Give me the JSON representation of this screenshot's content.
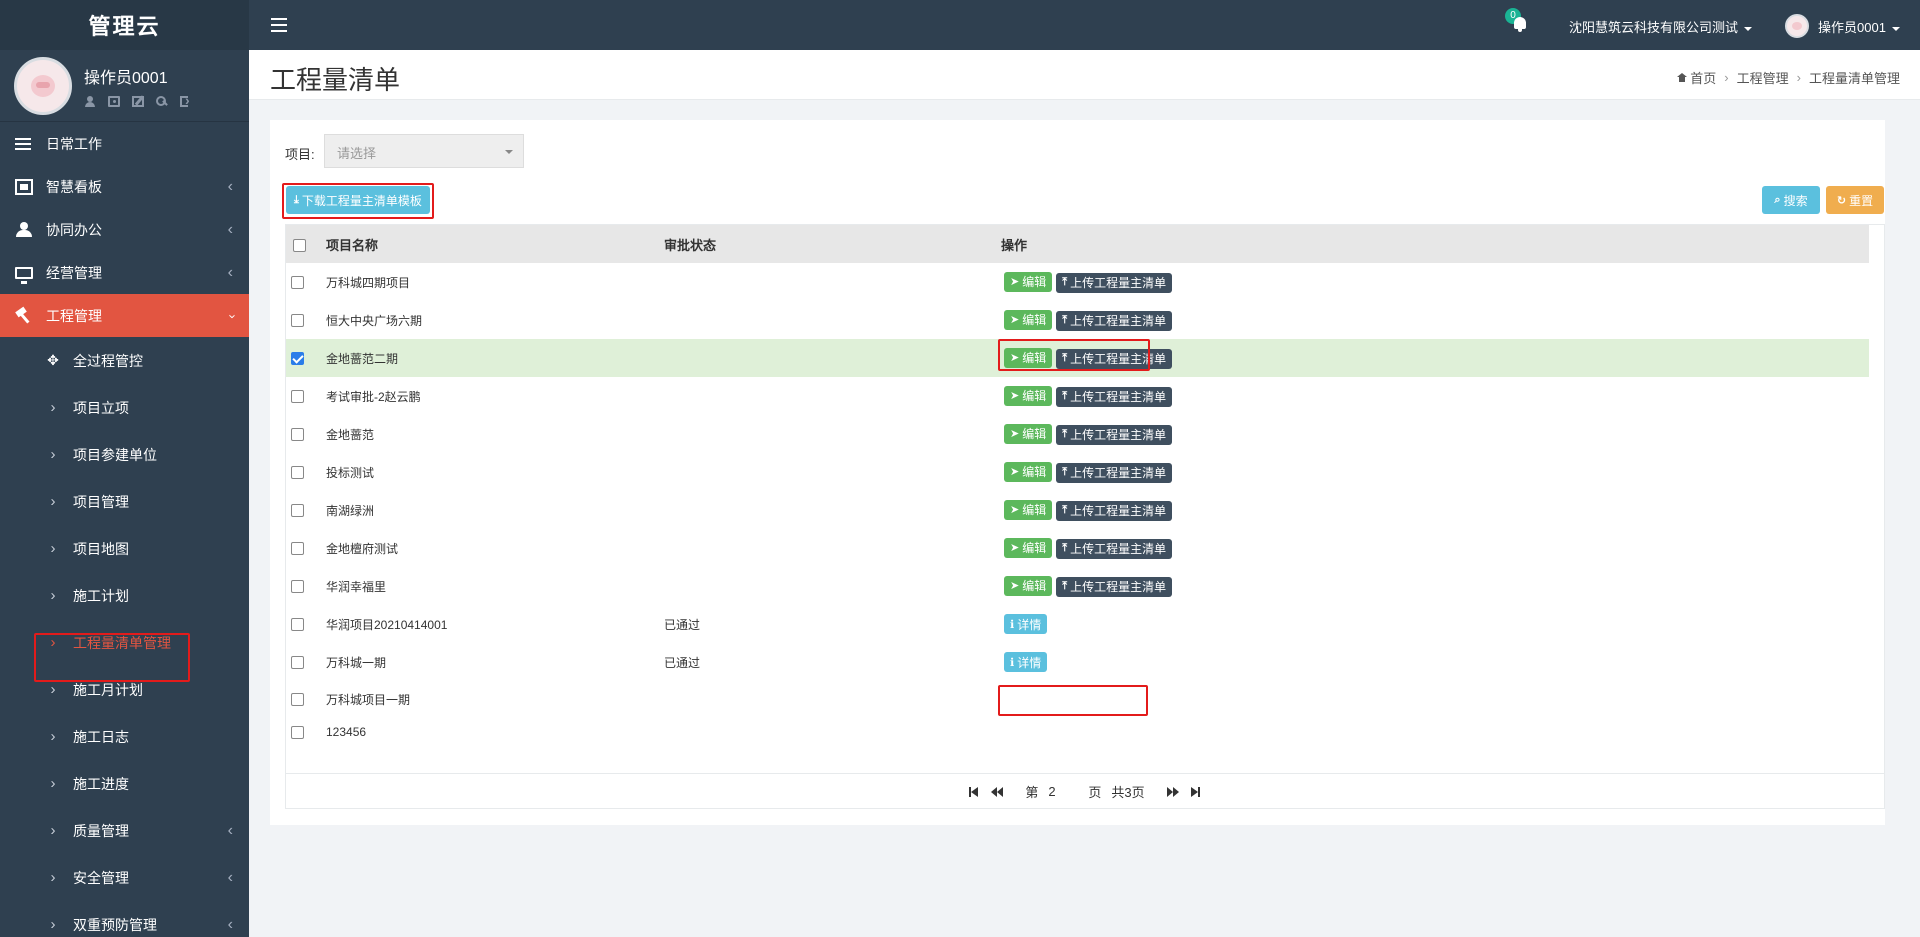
{
  "brand": "管理云",
  "user": {
    "name": "操作员0001",
    "tools": [
      "user-icon",
      "photo-icon",
      "edit-icon",
      "key-icon",
      "logout-icon"
    ]
  },
  "menu": [
    {
      "label": "日常工作",
      "icon": "list-icon"
    },
    {
      "label": "智慧看板",
      "icon": "dashboard-icon"
    },
    {
      "label": "协同办公",
      "icon": "users-icon"
    },
    {
      "label": "经营管理",
      "icon": "monitor-icon"
    },
    {
      "label": "工程管理",
      "icon": "hammer-icon"
    }
  ],
  "submenu": [
    {
      "label": "全过程管控"
    },
    {
      "label": "项目立项"
    },
    {
      "label": "项目参建单位"
    },
    {
      "label": "项目管理"
    },
    {
      "label": "项目地图"
    },
    {
      "label": "施工计划"
    },
    {
      "label": "工程量清单管理"
    },
    {
      "label": "施工月计划"
    },
    {
      "label": "施工日志"
    },
    {
      "label": "施工进度"
    },
    {
      "label": "质量管理"
    },
    {
      "label": "安全管理"
    },
    {
      "label": "双重预防管理"
    }
  ],
  "topbar": {
    "notification_count": "0",
    "company": "沈阳慧筑云科技有限公司测试",
    "user": "操作员0001"
  },
  "page": {
    "title": "工程量清单",
    "breadcrumb": [
      "首页",
      "工程管理",
      "工程量清单管理"
    ]
  },
  "filter": {
    "label": "项目:",
    "placeholder": "请选择"
  },
  "buttons": {
    "download": "下载工程量主清单模板",
    "search": "搜索",
    "reset": "重置",
    "edit": "编辑",
    "upload": "上传工程量主清单",
    "detail": "详情"
  },
  "table": {
    "columns": [
      "项目名称",
      "审批状态",
      "操作"
    ],
    "rows": [
      {
        "name": "万科城四期项目",
        "status": "",
        "actions": "edit-upload",
        "checked": false
      },
      {
        "name": "恒大中央广场六期",
        "status": "",
        "actions": "edit-upload",
        "checked": false
      },
      {
        "name": "金地蔷范二期",
        "status": "",
        "actions": "edit-upload",
        "checked": true
      },
      {
        "name": "考试审批-2赵云鹏",
        "status": "",
        "actions": "edit-upload",
        "checked": false
      },
      {
        "name": "金地蔷范",
        "status": "",
        "actions": "edit-upload",
        "checked": false
      },
      {
        "name": "投标测试",
        "status": "",
        "actions": "edit-upload",
        "checked": false
      },
      {
        "name": "南湖绿洲",
        "status": "",
        "actions": "edit-upload",
        "checked": false
      },
      {
        "name": "金地檀府测试",
        "status": "",
        "actions": "edit-upload",
        "checked": false
      },
      {
        "name": "华润幸福里",
        "status": "",
        "actions": "edit-upload",
        "checked": false
      },
      {
        "name": "华润项目20210414001",
        "status": "已通过",
        "actions": "detail",
        "checked": false
      },
      {
        "name": "万科城一期",
        "status": "已通过",
        "actions": "detail",
        "checked": false
      },
      {
        "name": "万科城项目一期",
        "status": "",
        "actions": "none",
        "checked": false
      },
      {
        "name": "123456",
        "status": "",
        "actions": "none",
        "checked": false
      }
    ]
  },
  "pager": {
    "prefix": "第",
    "page": "2",
    "suffix": "页",
    "total": "共3页"
  },
  "colors": {
    "sidebar": "#2f4050",
    "active_menu": "#e25541",
    "info": "#5bc0de",
    "warning": "#f0ad4e",
    "success": "#5cb85c",
    "dark_button": "#3f4f5f",
    "selected_row": "#dff0d8",
    "highlight_box": "#e31b1b"
  }
}
